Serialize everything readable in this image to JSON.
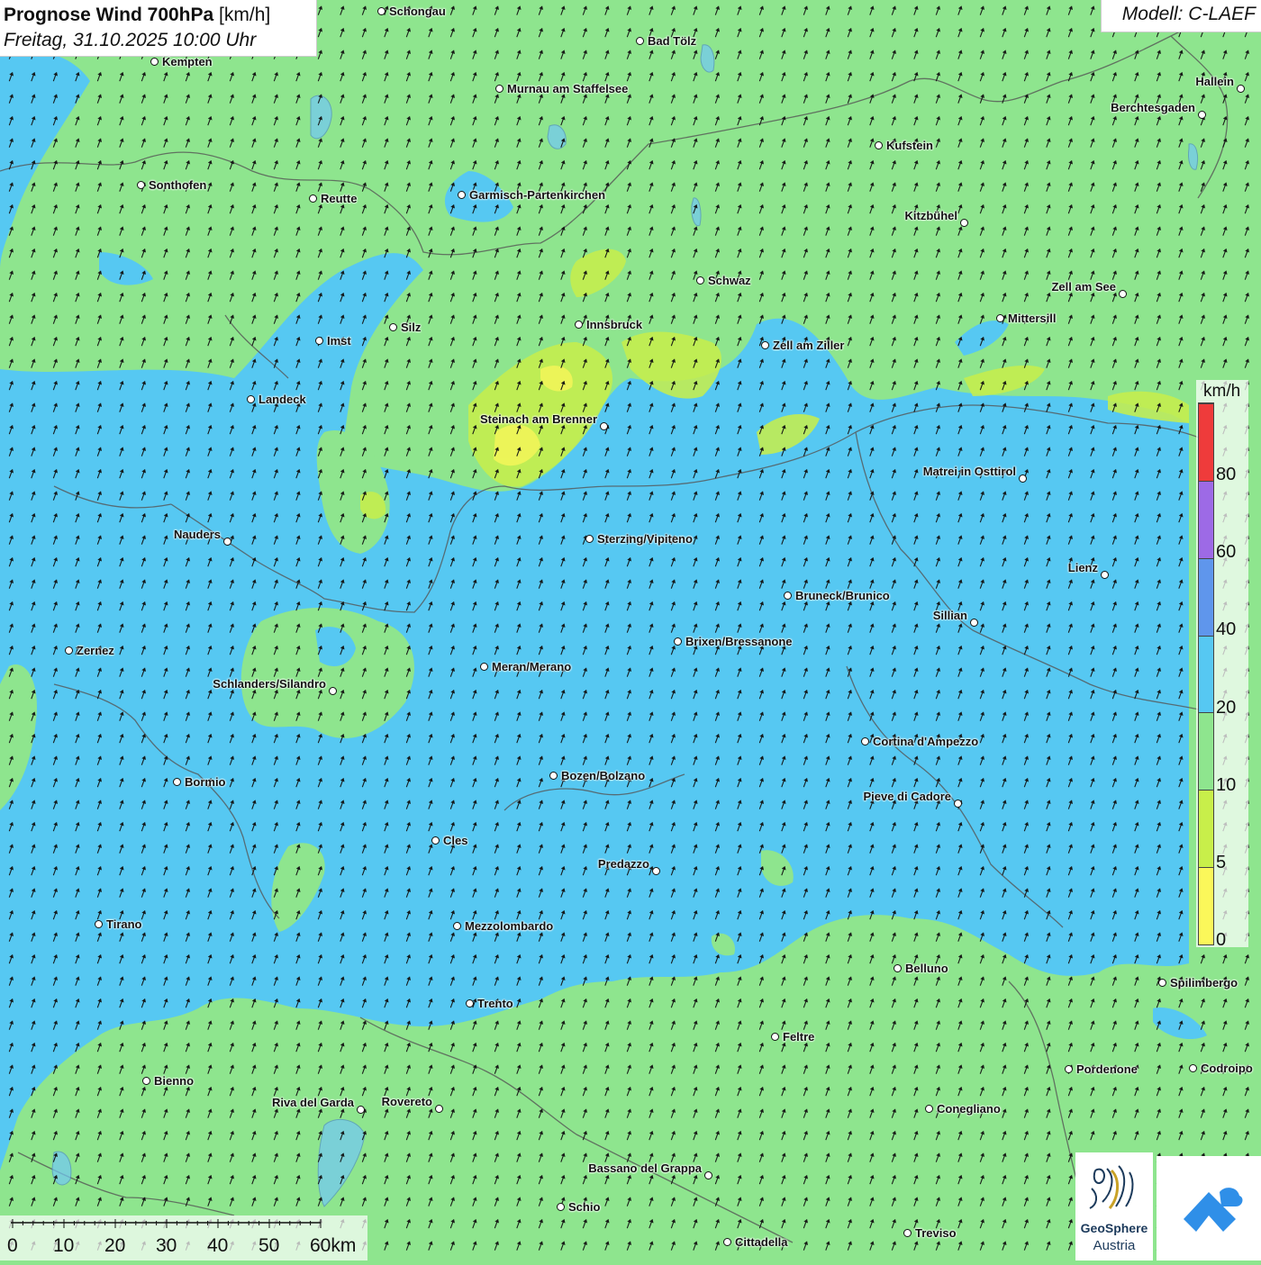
{
  "header": {
    "title": "Prognose Wind 700hPa",
    "unit_bracket": "[km/h]",
    "datetime": "Freitag, 31.10.2025 10:00 Uhr",
    "model": "Modell: C-LAEF"
  },
  "legend": {
    "unit": "km/h",
    "ticks": [
      "0",
      "5",
      "10",
      "20",
      "40",
      "60",
      "80"
    ],
    "colors": [
      "#fbf75a",
      "#c8ef4a",
      "#8ee58e",
      "#56c8f2",
      "#5f96ec",
      "#9d6ae6",
      "#ef3b3b"
    ]
  },
  "scale": {
    "labels": [
      "0",
      "10",
      "20",
      "30",
      "40",
      "50",
      "60km"
    ]
  },
  "logos": {
    "geosphere_line1": "GeoSphere",
    "geosphere_line2": "Austria"
  },
  "cities": [
    {
      "name": "Schongau"
    },
    {
      "name": "Bad Tölz"
    },
    {
      "name": "Kempten"
    },
    {
      "name": "Murnau am Staffelsee"
    },
    {
      "name": "Hallein"
    },
    {
      "name": "Berchtesgaden"
    },
    {
      "name": "Kufstein"
    },
    {
      "name": "Sonthofen"
    },
    {
      "name": "Reutte"
    },
    {
      "name": "Garmisch-Partenkirchen"
    },
    {
      "name": "Kitzbühel"
    },
    {
      "name": "Schwaz"
    },
    {
      "name": "Zell am See"
    },
    {
      "name": "Innsbruck"
    },
    {
      "name": "Mittersill"
    },
    {
      "name": "Imst"
    },
    {
      "name": "Silz"
    },
    {
      "name": "Zell am Ziller"
    },
    {
      "name": "Landeck"
    },
    {
      "name": "Steinach am Brenner"
    },
    {
      "name": "Matrei in Osttirol"
    },
    {
      "name": "Nauders"
    },
    {
      "name": "Sterzing/Vipiteno"
    },
    {
      "name": "Lienz"
    },
    {
      "name": "Bruneck/Brunico"
    },
    {
      "name": "Sillian"
    },
    {
      "name": "Zernez"
    },
    {
      "name": "Brixen/Bressanone"
    },
    {
      "name": "Meran/Merano"
    },
    {
      "name": "Schlanders/Silandro"
    },
    {
      "name": "Cortina d'Ampezzo"
    },
    {
      "name": "Bormio"
    },
    {
      "name": "Bozen/Bolzano"
    },
    {
      "name": "Pieve di Cadore"
    },
    {
      "name": "Cles"
    },
    {
      "name": "Predazzo"
    },
    {
      "name": "Tirano"
    },
    {
      "name": "Mezzolombardo"
    },
    {
      "name": "Belluno"
    },
    {
      "name": "Spilimbergo"
    },
    {
      "name": "Trento"
    },
    {
      "name": "Feltre"
    },
    {
      "name": "Pordenone"
    },
    {
      "name": "Codroipo"
    },
    {
      "name": "Bienno"
    },
    {
      "name": "Riva del Garda"
    },
    {
      "name": "Rovereto"
    },
    {
      "name": "Conegliano"
    },
    {
      "name": "Bassano del Grappa"
    },
    {
      "name": "Schio"
    },
    {
      "name": "Treviso"
    },
    {
      "name": "Cittadella"
    }
  ]
}
